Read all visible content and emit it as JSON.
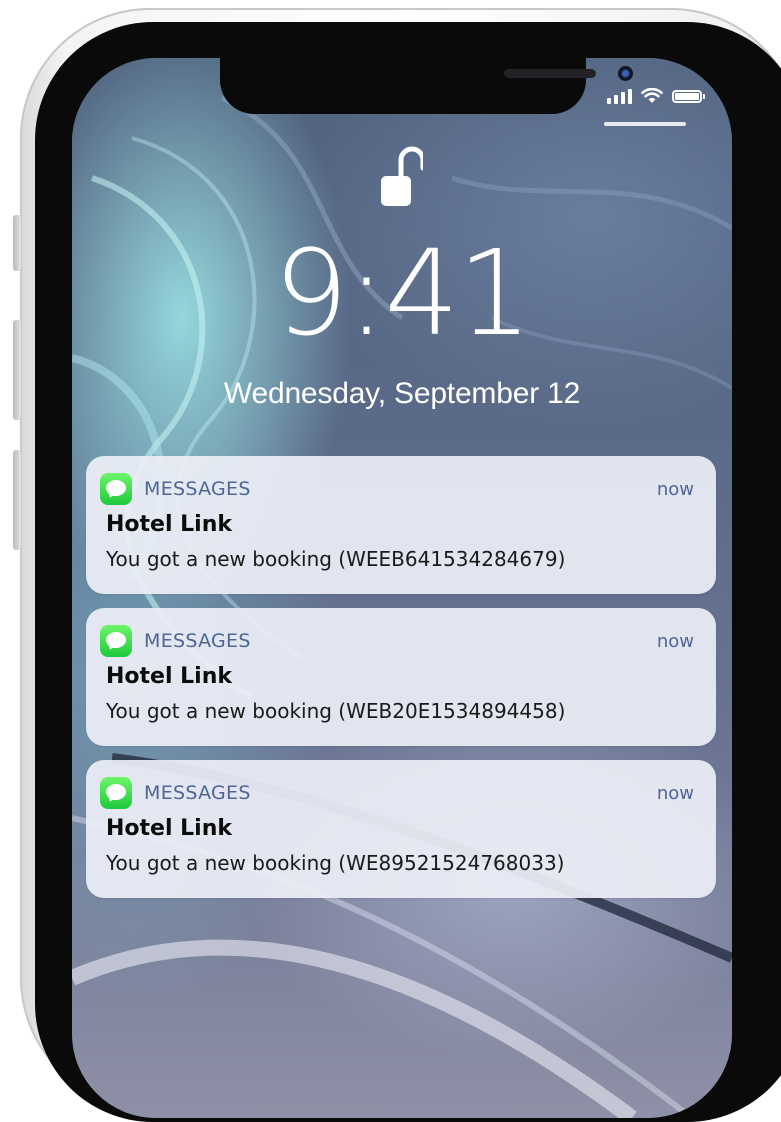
{
  "status_bar": {
    "signal_icon": "cellular-signal-icon",
    "wifi_icon": "wifi-icon",
    "battery_icon": "battery-icon",
    "battery_level": 1.0
  },
  "lock_screen": {
    "lock_icon": "unlocked-padlock-icon",
    "time": "9:41",
    "date": "Wednesday, September 12"
  },
  "notifications": [
    {
      "app_icon": "messages-app-icon",
      "app_name": "MESSAGES",
      "time": "now",
      "title": "Hotel Link",
      "body": "You got a new booking (WEEB641534284679)"
    },
    {
      "app_icon": "messages-app-icon",
      "app_name": "MESSAGES",
      "time": "now",
      "title": "Hotel Link",
      "body": "You got a new booking (WEB20E1534894458)"
    },
    {
      "app_icon": "messages-app-icon",
      "app_name": "MESSAGES",
      "time": "now",
      "title": "Hotel Link",
      "body": "You got a new booking (WE89521524768033)"
    }
  ],
  "colors": {
    "notification_accent": "#4e6596",
    "messages_green": "#2fd24a",
    "card_background": "#eceef6"
  }
}
